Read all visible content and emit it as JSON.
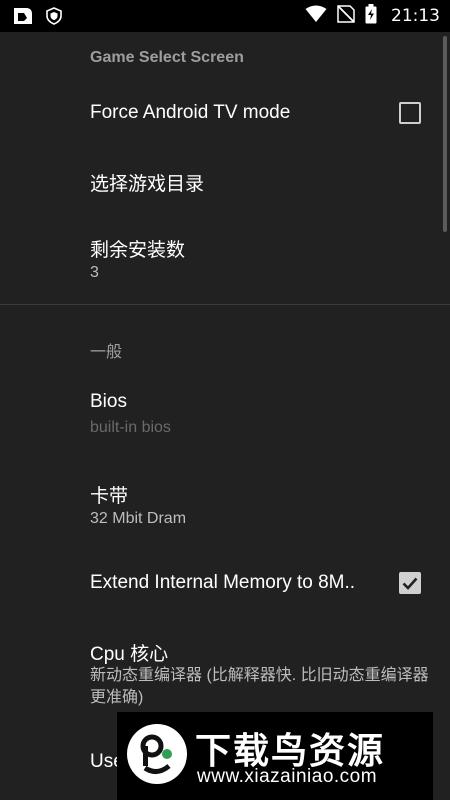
{
  "status_bar": {
    "time": "21:13",
    "icons": [
      "app-notification-icon",
      "shield-icon",
      "wifi-icon",
      "no-sim-icon",
      "battery-charging-icon"
    ]
  },
  "sections": {
    "game_select": {
      "header": "Game Select Screen",
      "force_tv": {
        "title": "Force Android TV mode",
        "checked": false
      },
      "select_dir": {
        "title": "选择游戏目录"
      },
      "installs": {
        "title": "剩余安装数",
        "summary": "3"
      }
    },
    "general": {
      "header": "一般",
      "bios": {
        "title": "Bios",
        "summary": "built-in bios"
      },
      "cartridge": {
        "title": "卡带",
        "summary": "32 Mbit Dram"
      },
      "extend_memory": {
        "title": "Extend Internal Memory to 8M..",
        "checked": true
      },
      "cpu": {
        "title": "Cpu 核心",
        "summary": "新动态重编译器 (比解释器快. 比旧动态重编译器更准确)"
      },
      "next_partial": {
        "title": "Use"
      }
    }
  },
  "watermark": {
    "title": "下载鸟资源",
    "url": "www.xiazainiao.com"
  },
  "colors": {
    "background": "#212121",
    "status_bar": "#000000",
    "category_text": "#9e9e9e",
    "summary_text": "#bdbdbd"
  }
}
